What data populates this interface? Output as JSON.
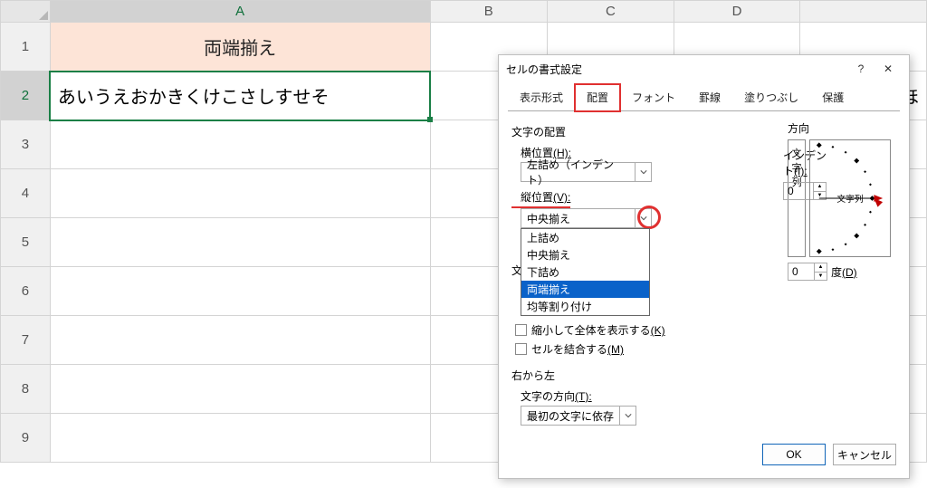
{
  "columns": [
    "A",
    "B",
    "C",
    "D"
  ],
  "rows": [
    "1",
    "2",
    "3",
    "4",
    "5",
    "6",
    "7",
    "8",
    "9"
  ],
  "cells": {
    "A1": "両端揃え",
    "A2": "あいうえおかきくけこさしすせそ",
    "overflow_right": "ほ"
  },
  "dialog": {
    "title": "セルの書式設定",
    "help_glyph": "?",
    "close_glyph": "✕",
    "tabs": [
      "表示形式",
      "配置",
      "フォント",
      "罫線",
      "塗りつぶし",
      "保護"
    ],
    "alignment": {
      "group_label": "文字の配置",
      "horizontal_label": "横位置",
      "horizontal_key": "(H):",
      "horizontal_value": "左詰め（インデント）",
      "indent_label": "インデント",
      "indent_key": "(I):",
      "indent_value": "0",
      "vertical_label": "縦位置",
      "vertical_key": "(V):",
      "vertical_value": "中央揃え",
      "vertical_options": [
        "上詰め",
        "中央揃え",
        "下詰め",
        "両端揃え",
        "均等割り付け"
      ],
      "vertical_selected": "両端揃え",
      "control_label_prefix": "文",
      "shrink_label": "縮小して全体を表示する",
      "shrink_key": "(K)",
      "merge_label": "セルを結合する",
      "merge_key": "(M)"
    },
    "rtl": {
      "group_label": "右から左",
      "direction_label": "文字の方向",
      "direction_key": "(T):",
      "direction_value": "最初の文字に依存"
    },
    "orientation": {
      "label": "方向",
      "vertical_text": "文字列",
      "axis_text": "文字列",
      "deg_value": "0",
      "deg_label": "度",
      "deg_key": "(D)"
    },
    "buttons": {
      "ok": "OK",
      "cancel": "キャンセル"
    }
  }
}
